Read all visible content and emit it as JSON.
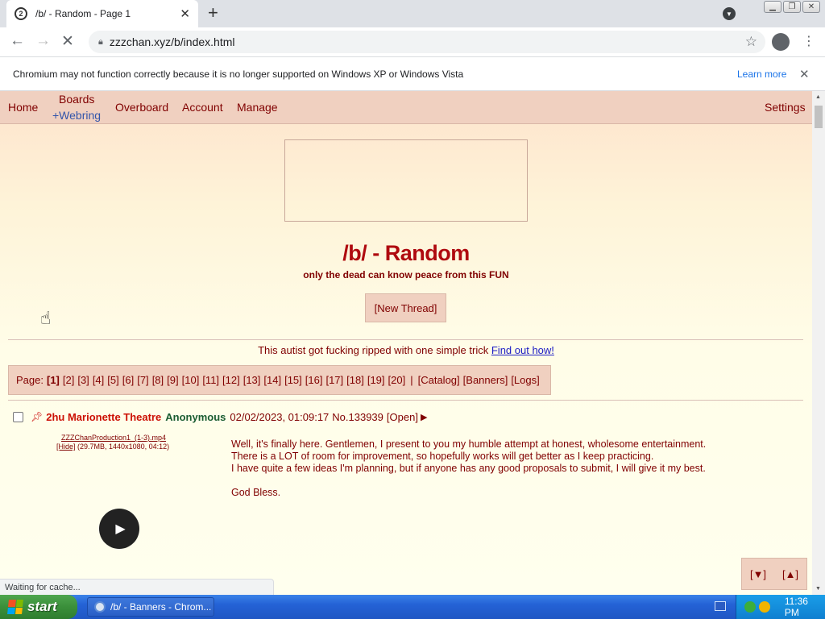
{
  "browser": {
    "tab_title": "/b/ - Random - Page 1",
    "tab_favicon": "2",
    "url": "zzzchan.xyz/b/index.html",
    "infobar_text": "Chromium may not function correctly because it is no longer supported on Windows XP or Windows Vista",
    "infobar_link": "Learn more",
    "status_text": "Waiting for cache..."
  },
  "site_nav": {
    "home": "Home",
    "boards": "Boards",
    "webring": "+Webring",
    "overboard": "Overboard",
    "account": "Account",
    "manage": "Manage",
    "settings": "Settings"
  },
  "board": {
    "title": "/b/ - Random",
    "subtitle": "only the dead can know peace from this FUN",
    "new_thread": "[New Thread]",
    "announcement_text": "This autist got fucking ripped with one simple trick",
    "announcement_link": "Find out how!"
  },
  "pagination": {
    "label": "Page:",
    "pages": [
      "[1]",
      "[2]",
      "[3]",
      "[4]",
      "[5]",
      "[6]",
      "[7]",
      "[8]",
      "[9]",
      "[10]",
      "[11]",
      "[12]",
      "[13]",
      "[14]",
      "[15]",
      "[16]",
      "[17]",
      "[18]",
      "[19]",
      "[20]"
    ],
    "current": "[1]",
    "separator": "|",
    "catalog": "[Catalog]",
    "banners": "[Banners]",
    "logs": "[Logs]"
  },
  "thread": {
    "subject": "2hu Marionette Theatre",
    "name": "Anonymous",
    "date": "02/02/2023, 01:09:17",
    "number": "No.133939",
    "open": "[Open]",
    "file_name": "ZZZChanProduction1_(1-3).mp4",
    "file_hide": "[Hide]",
    "file_meta": "(29.7MB, 1440x1080, 04:12)",
    "body": [
      "Well, it's finally here. Gentlemen, I present to you my humble attempt at honest, wholesome entertainment.",
      "There is a LOT of room for improvement, so hopefully works will get better as I keep practicing.",
      "I have quite a few ideas I'm planning, but if anyone has any good proposals to submit, I will give it my best.",
      "",
      "God Bless."
    ]
  },
  "scroll_nav": {
    "down": "[▼]",
    "up": "[▲]"
  },
  "taskbar": {
    "start": "start",
    "window": "/b/ - Banners - Chrom...",
    "clock": "11:36 PM"
  },
  "colors": {
    "board_title": "#af0a0f",
    "text": "#800000",
    "nav_bg": "#f0d0c0",
    "link": "#1c1cc4"
  }
}
